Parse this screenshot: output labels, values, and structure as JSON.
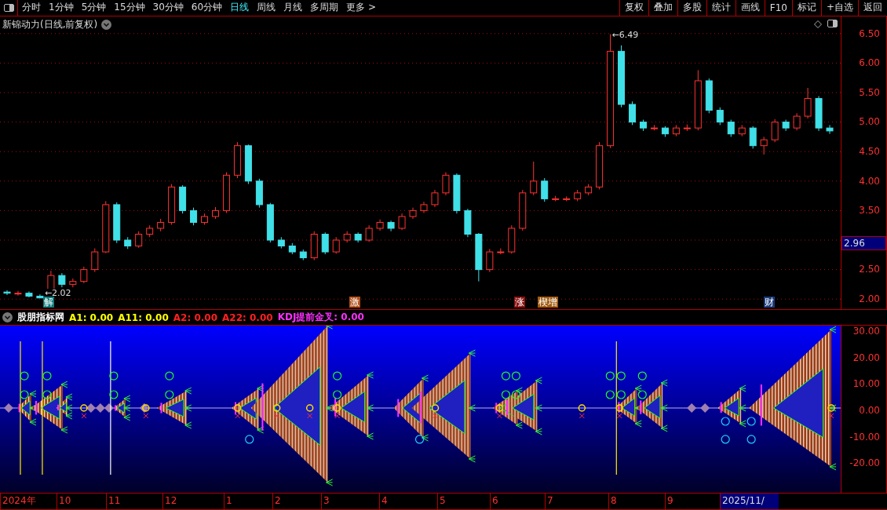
{
  "toolbar": {
    "periods": [
      {
        "label": "分时",
        "selected": false
      },
      {
        "label": "1分钟",
        "selected": false
      },
      {
        "label": "5分钟",
        "selected": false
      },
      {
        "label": "15分钟",
        "selected": false
      },
      {
        "label": "30分钟",
        "selected": false
      },
      {
        "label": "60分钟",
        "selected": false
      },
      {
        "label": "日线",
        "selected": true
      },
      {
        "label": "周线",
        "selected": false
      },
      {
        "label": "月线",
        "selected": false
      },
      {
        "label": "多周期",
        "selected": false
      },
      {
        "label": "更多 >",
        "selected": false
      }
    ],
    "buttons": [
      "复权",
      "叠加",
      "多股",
      "统计",
      "画线",
      "F10",
      "标记",
      "+自选",
      "返回"
    ]
  },
  "main_chart": {
    "title": "新锦动力(日线,前复权)",
    "current_price": "2.96",
    "price_marks": [
      {
        "kind": "high",
        "label": "←6.49"
      },
      {
        "kind": "low",
        "label": "←2.02"
      }
    ],
    "chart_data": {
      "type": "candlestick",
      "ylim": [
        1.79,
        6.79
      ],
      "grid": true,
      "yticks": [
        {
          "value": 2,
          "label": "2.00"
        },
        {
          "value": 2.5,
          "label": "2.50"
        },
        {
          "value": 3.5,
          "label": "3.50"
        },
        {
          "value": 4,
          "label": "4.00"
        },
        {
          "value": 4.5,
          "label": "4.50"
        },
        {
          "value": 5,
          "label": "5.00"
        },
        {
          "value": 5.5,
          "label": "5.50"
        },
        {
          "value": 6,
          "label": "6.00"
        },
        {
          "value": 6.5,
          "label": "6.50"
        }
      ],
      "ohlc": [
        [
          2.12,
          2.15,
          2.07,
          2.1
        ],
        [
          2.1,
          2.14,
          2.06,
          2.1
        ],
        [
          2.1,
          2.13,
          2.03,
          2.05
        ],
        [
          2.05,
          2.08,
          2.02,
          2.02
        ],
        [
          2.03,
          2.48,
          2.03,
          2.4
        ],
        [
          2.4,
          2.44,
          2.2,
          2.25
        ],
        [
          2.25,
          2.35,
          2.2,
          2.3
        ],
        [
          2.3,
          2.55,
          2.27,
          2.5
        ],
        [
          2.5,
          2.86,
          2.46,
          2.8
        ],
        [
          2.8,
          3.66,
          2.78,
          3.6
        ],
        [
          3.6,
          3.64,
          2.95,
          3.0
        ],
        [
          3.0,
          3.05,
          2.85,
          2.9
        ],
        [
          2.9,
          3.15,
          2.87,
          3.1
        ],
        [
          3.1,
          3.25,
          3.05,
          3.2
        ],
        [
          3.2,
          3.36,
          3.15,
          3.3
        ],
        [
          3.3,
          3.95,
          3.26,
          3.9
        ],
        [
          3.9,
          3.93,
          3.45,
          3.5
        ],
        [
          3.5,
          3.55,
          3.25,
          3.3
        ],
        [
          3.3,
          3.45,
          3.26,
          3.4
        ],
        [
          3.4,
          3.56,
          3.36,
          3.5
        ],
        [
          3.5,
          4.15,
          3.46,
          4.1
        ],
        [
          4.1,
          4.66,
          4.05,
          4.6
        ],
        [
          4.6,
          4.62,
          3.95,
          4.0
        ],
        [
          4.0,
          4.04,
          3.55,
          3.6
        ],
        [
          3.6,
          3.63,
          2.96,
          3.0
        ],
        [
          3.0,
          3.05,
          2.86,
          2.9
        ],
        [
          2.9,
          2.95,
          2.76,
          2.8
        ],
        [
          2.8,
          2.84,
          2.66,
          2.7
        ],
        [
          2.7,
          3.15,
          2.66,
          3.1
        ],
        [
          3.1,
          3.13,
          2.76,
          2.8
        ],
        [
          2.8,
          3.05,
          2.77,
          3.0
        ],
        [
          3.0,
          3.15,
          2.96,
          3.1
        ],
        [
          3.1,
          3.13,
          2.96,
          3.0
        ],
        [
          3.0,
          3.25,
          2.97,
          3.2
        ],
        [
          3.2,
          3.35,
          3.16,
          3.3
        ],
        [
          3.3,
          3.33,
          3.15,
          3.2
        ],
        [
          3.2,
          3.45,
          3.17,
          3.4
        ],
        [
          3.4,
          3.55,
          3.36,
          3.5
        ],
        [
          3.5,
          3.65,
          3.46,
          3.6
        ],
        [
          3.6,
          3.85,
          3.56,
          3.8
        ],
        [
          3.8,
          4.15,
          3.76,
          4.1
        ],
        [
          4.1,
          4.13,
          3.45,
          3.5
        ],
        [
          3.5,
          3.53,
          3.05,
          3.1
        ],
        [
          3.1,
          3.12,
          2.3,
          2.5
        ],
        [
          2.5,
          2.85,
          2.46,
          2.8
        ],
        [
          2.8,
          2.86,
          2.76,
          2.8
        ],
        [
          2.8,
          3.25,
          2.77,
          3.2
        ],
        [
          3.2,
          3.85,
          3.16,
          3.8
        ],
        [
          3.8,
          4.33,
          3.76,
          4.0
        ],
        [
          4.0,
          4.05,
          3.65,
          3.7
        ],
        [
          3.7,
          3.75,
          3.66,
          3.7
        ],
        [
          3.7,
          3.74,
          3.66,
          3.7
        ],
        [
          3.7,
          3.85,
          3.66,
          3.8
        ],
        [
          3.8,
          3.95,
          3.76,
          3.9
        ],
        [
          3.9,
          4.66,
          3.86,
          4.6
        ],
        [
          4.6,
          6.49,
          4.56,
          6.2
        ],
        [
          6.2,
          6.3,
          5.25,
          5.3
        ],
        [
          5.3,
          5.35,
          4.95,
          5.0
        ],
        [
          5.0,
          5.04,
          4.85,
          4.9
        ],
        [
          4.9,
          4.95,
          4.86,
          4.9
        ],
        [
          4.9,
          4.93,
          4.75,
          4.8
        ],
        [
          4.8,
          4.95,
          4.76,
          4.9
        ],
        [
          4.9,
          4.96,
          4.85,
          4.9
        ],
        [
          4.9,
          5.88,
          4.86,
          5.7
        ],
        [
          5.7,
          5.74,
          5.15,
          5.2
        ],
        [
          5.2,
          5.25,
          4.95,
          5.0
        ],
        [
          5.0,
          5.04,
          4.75,
          4.8
        ],
        [
          4.8,
          4.95,
          4.76,
          4.9
        ],
        [
          4.9,
          4.93,
          4.55,
          4.6
        ],
        [
          4.6,
          4.75,
          4.45,
          4.7
        ],
        [
          4.7,
          5.05,
          4.66,
          5.0
        ],
        [
          5.0,
          5.04,
          4.85,
          4.9
        ],
        [
          4.9,
          5.15,
          4.86,
          5.1
        ],
        [
          5.1,
          5.58,
          5.06,
          5.4
        ],
        [
          5.4,
          5.44,
          4.85,
          4.9
        ],
        [
          4.9,
          4.95,
          4.8,
          4.85
        ]
      ]
    },
    "tags": [
      {
        "label": "解",
        "color": "#0a7a7a"
      },
      {
        "label": "激",
        "color": "#b0501a"
      },
      {
        "label": "涨",
        "color": "#8a1010"
      },
      {
        "label": "楔增",
        "color": "#a05a10"
      },
      {
        "label": "财",
        "color": "#1a3a7a"
      }
    ]
  },
  "indicator": {
    "legend": [
      {
        "label": "股朋指标网",
        "color": "#ffffff"
      },
      {
        "label": "A1: 0.00",
        "color": "#ffff00"
      },
      {
        "label": "A11: 0.00",
        "color": "#ffff00"
      },
      {
        "label": "A2: 0.00",
        "color": "#ff2020"
      },
      {
        "label": "A22: 0.00",
        "color": "#ff2020"
      },
      {
        "label": "KDJ提前金叉: 0.00",
        "color": "#ff30ff"
      }
    ],
    "axis_labels": [
      "30.00",
      "20.00",
      "10.00",
      "0.00",
      "-10.00",
      "-20.00"
    ]
  },
  "date_axis": [
    {
      "label": "2024年",
      "selected": false
    },
    {
      "label": "10",
      "selected": false
    },
    {
      "label": "11",
      "selected": false
    },
    {
      "label": "12",
      "selected": false
    },
    {
      "label": "1",
      "selected": false
    },
    {
      "label": "2",
      "selected": false
    },
    {
      "label": "3",
      "selected": false
    },
    {
      "label": "4",
      "selected": false
    },
    {
      "label": "5",
      "selected": false
    },
    {
      "label": "6",
      "selected": false
    },
    {
      "label": "7",
      "selected": false
    },
    {
      "label": "8",
      "selected": false
    },
    {
      "label": "9",
      "selected": false
    },
    {
      "label": "2025/11/",
      "selected": true
    }
  ]
}
